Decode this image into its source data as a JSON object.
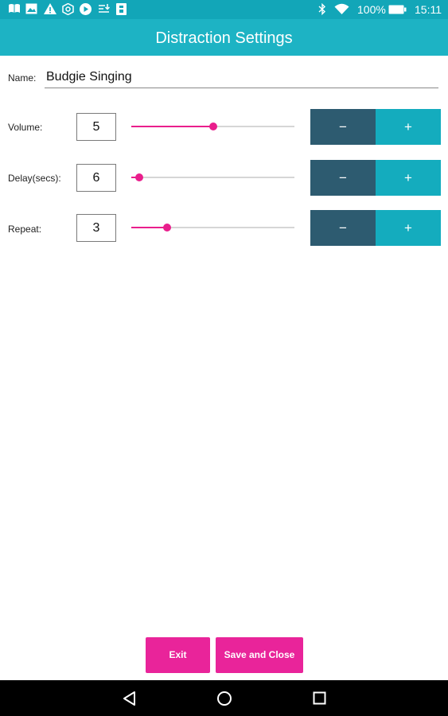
{
  "status_bar": {
    "icons": [
      "book-icon",
      "image-icon",
      "warning-icon",
      "settings-hex-icon",
      "play-icon",
      "download-icon",
      "badge-icon",
      "bluetooth-icon",
      "wifi-icon",
      "battery-icon"
    ],
    "battery_percent": "100%",
    "time": "15:11"
  },
  "header": {
    "title": "Distraction Settings"
  },
  "name": {
    "label": "Name:",
    "value": "Budgie Singing"
  },
  "settings": [
    {
      "label": "Volume:",
      "value": "5",
      "slider_fraction": 0.5,
      "minus": "−",
      "plus": "+"
    },
    {
      "label": "Delay(secs):",
      "value": "6",
      "slider_fraction": 0.05,
      "minus": "−",
      "plus": "+"
    },
    {
      "label": "Repeat:",
      "value": "3",
      "slider_fraction": 0.22,
      "minus": "−",
      "plus": "+"
    }
  ],
  "footer": {
    "exit_label": "Exit",
    "save_label": "Save and Close"
  },
  "nav": {
    "icons": [
      "back-icon",
      "home-icon",
      "recents-icon"
    ]
  },
  "colors": {
    "status_bar": "#12a6b8",
    "title_bar": "#1db3c4",
    "accent_pink": "#e91e8c",
    "minus_button": "#2d5b70",
    "plus_button": "#14acbe"
  }
}
